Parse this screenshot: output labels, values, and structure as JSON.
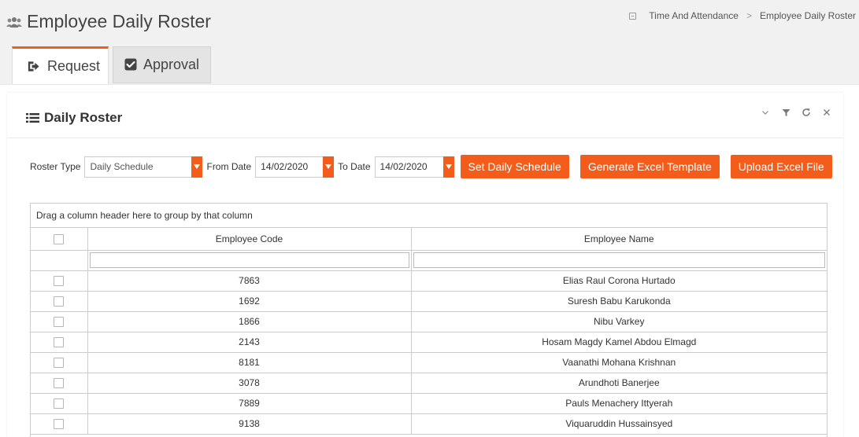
{
  "header": {
    "title": "Employee Daily Roster",
    "icon": "users-icon"
  },
  "breadcrumb": {
    "items": [
      "Time And Attendance",
      "Employee Daily Roster"
    ],
    "separator": ">"
  },
  "tabs": [
    {
      "label": "Request",
      "icon": "sign-out-icon",
      "active": true
    },
    {
      "label": "Approval",
      "icon": "checkbox-icon",
      "active": false
    }
  ],
  "panel": {
    "title": "Daily Roster",
    "tools": [
      "chevron-down-icon",
      "filter-icon",
      "refresh-icon",
      "close-icon"
    ]
  },
  "filters": {
    "roster_type_label": "Roster Type",
    "roster_type_value": "Daily Schedule",
    "from_date_label": "From Date",
    "from_date_value": "14/02/2020",
    "to_date_label": "To Date",
    "to_date_value": "14/02/2020"
  },
  "buttons": {
    "set_schedule": "Set Daily Schedule",
    "generate_template": "Generate Excel Template",
    "upload_file": "Upload Excel File"
  },
  "grid": {
    "group_hint": "Drag a column header here to group by that column",
    "columns": [
      "Employee Code",
      "Employee Name"
    ],
    "rows": [
      {
        "code": "7863",
        "name": "Elias Raul Corona Hurtado"
      },
      {
        "code": "1692",
        "name": "Suresh Babu Karukonda"
      },
      {
        "code": "1866",
        "name": "Nibu Varkey"
      },
      {
        "code": "2143",
        "name": "Hosam Magdy Kamel Abdou Elmagd"
      },
      {
        "code": "8181",
        "name": "Vaanathi Mohana Krishnan"
      },
      {
        "code": "3078",
        "name": "Arundhoti Banerjee"
      },
      {
        "code": "7889",
        "name": "Pauls Menachery Ittyerah"
      },
      {
        "code": "9138",
        "name": "Viquaruddin Hussainsyed"
      }
    ]
  },
  "colors": {
    "accent": "#f35c1a",
    "background": "#f1f1f1"
  }
}
